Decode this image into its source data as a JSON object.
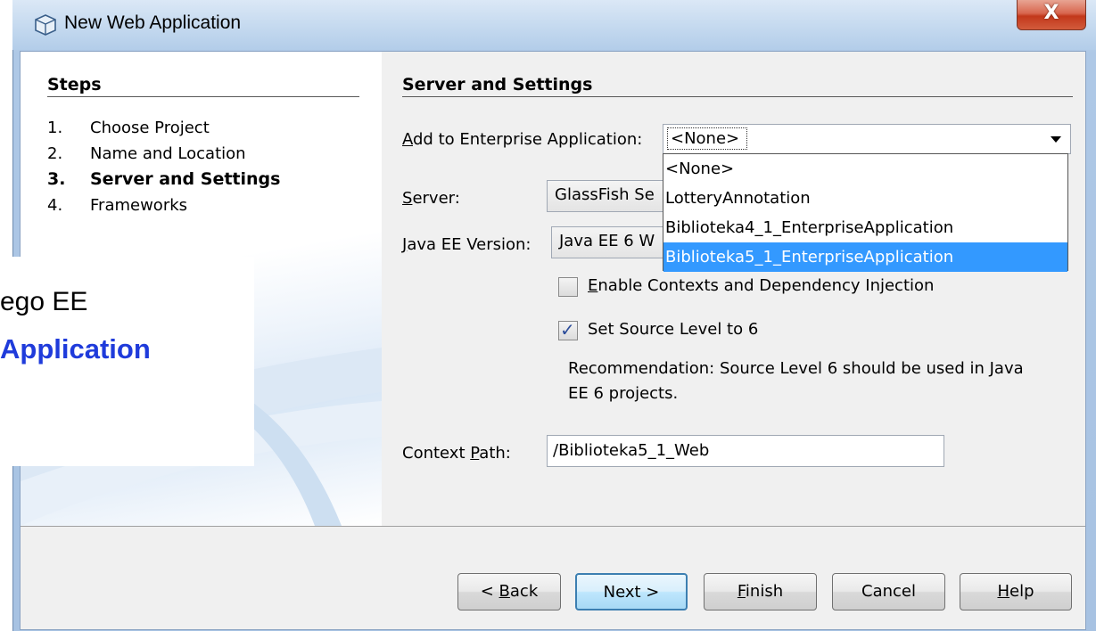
{
  "window": {
    "title": "New Web Application",
    "close_label": "X"
  },
  "steps": {
    "heading": "Steps",
    "items": [
      {
        "num": "1.",
        "label": "Choose Project"
      },
      {
        "num": "2.",
        "label": "Name and Location"
      },
      {
        "num": "3.",
        "label": "Server and Settings"
      },
      {
        "num": "4.",
        "label": "Frameworks"
      }
    ],
    "current_index": 2
  },
  "panel": {
    "heading": "Server and Settings",
    "enterprise_label_u": "A",
    "enterprise_label_rest": "dd to Enterprise Application:",
    "enterprise_value": "<None>",
    "enterprise_options": [
      "<None>",
      "LotteryAnnotation",
      "Biblioteka4_1_EnterpriseApplication",
      "Biblioteka5_1_EnterpriseApplication"
    ],
    "enterprise_selected_index": 3,
    "server_label_u": "S",
    "server_label_rest": "erver:",
    "server_value": "GlassFish Se",
    "javaee_label_u": "J",
    "javaee_label_rest": "ava EE Version:",
    "javaee_value": "Java EE 6 W",
    "cdi_label_u": "E",
    "cdi_label_rest": "nable Contexts and Dependency Injection",
    "cdi_checked": false,
    "source_label": "Set Source Level to 6",
    "source_checked": true,
    "recommendation": "Recommendation: Source Level 6 should be used in Java",
    "recommendation_line2": "EE 6 projects.",
    "context_label_pre": "Context ",
    "context_label_u": "P",
    "context_label_rest": "ath:",
    "context_value": "/Biblioteka5_1_Web"
  },
  "buttons": {
    "back_pre": "< ",
    "back_u": "B",
    "back_rest": "ack",
    "next": "Next >",
    "finish_u": "F",
    "finish_rest": "inish",
    "cancel": "Cancel",
    "help_u": "H",
    "help_rest": "elp"
  },
  "overlay": {
    "line1": "ego EE",
    "line2": "Application"
  }
}
